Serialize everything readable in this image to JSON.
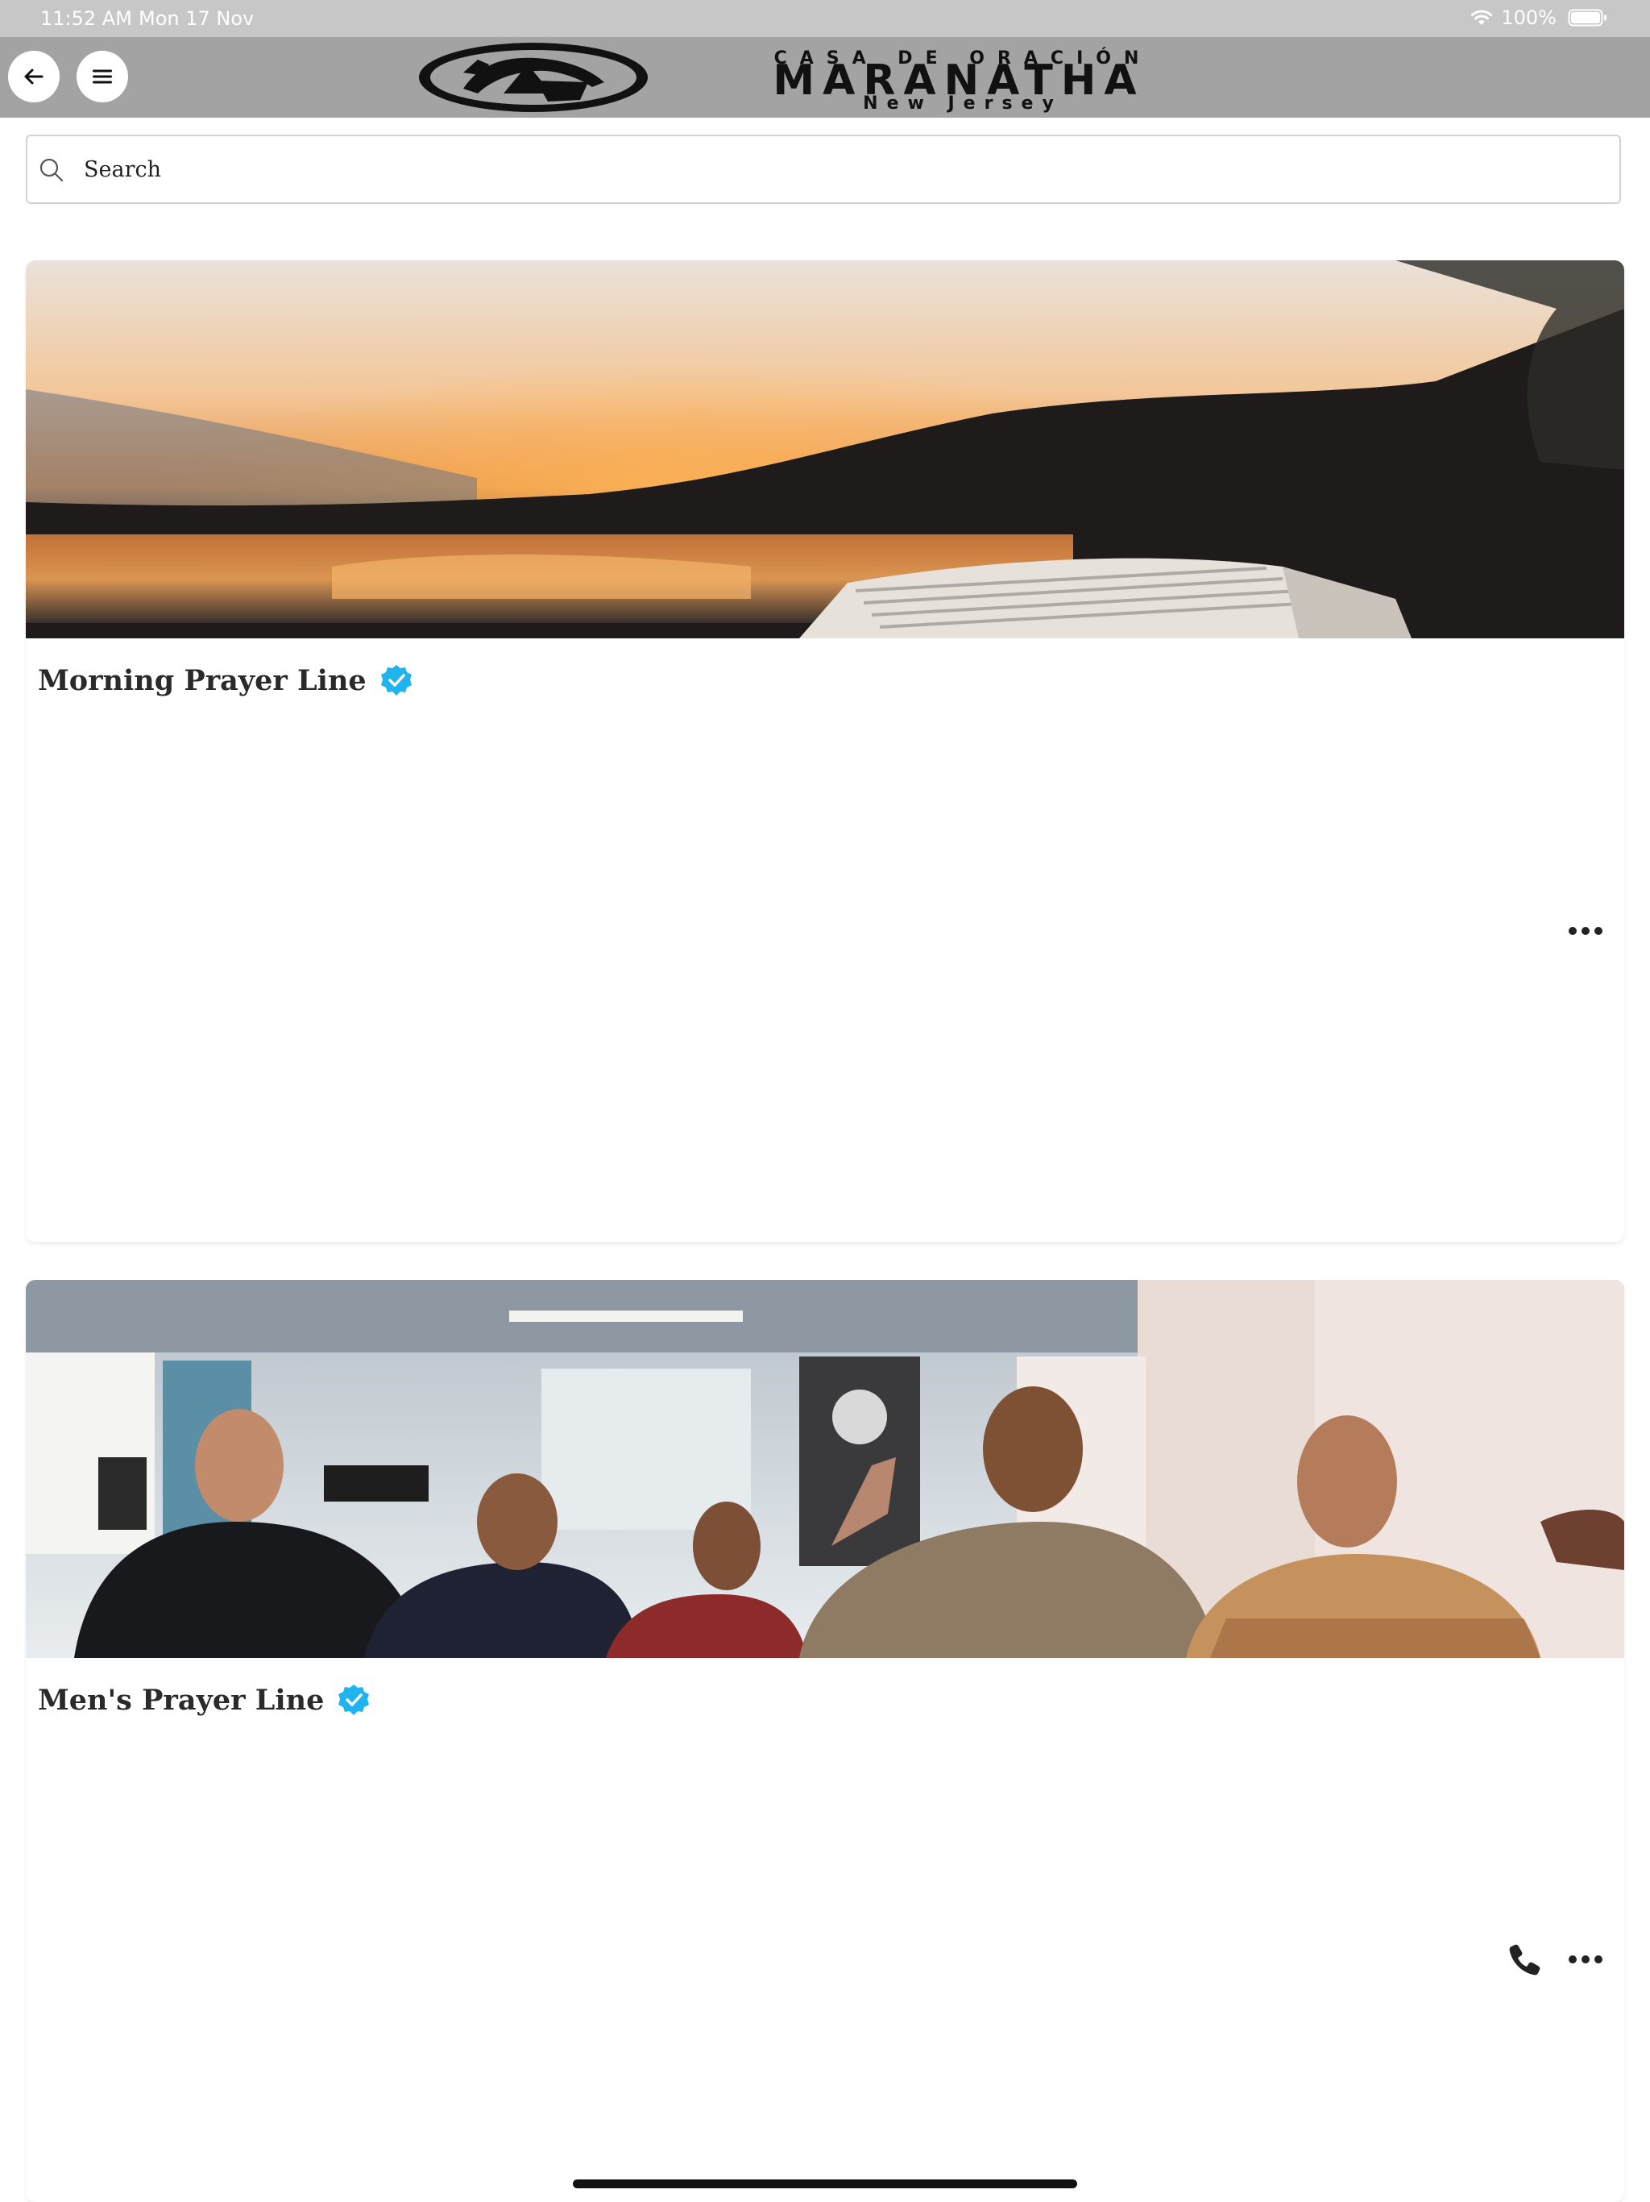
{
  "status_bar": {
    "time": "11:52 AM",
    "date": "Mon 17 Nov",
    "battery": "100%"
  },
  "header": {
    "logo": {
      "top_text": "CASA DE ORACIÓN",
      "main_text": "MARANATHA",
      "sub_text": "New Jersey"
    },
    "icons": {
      "back": "arrow-left-icon",
      "menu": "hamburger-menu-icon"
    },
    "background_color": "#a3a3a3"
  },
  "search": {
    "placeholder": "Search",
    "value": ""
  },
  "cards": [
    {
      "title": "Morning Prayer Line",
      "verified": true,
      "image": "sunset-lake-open-bible",
      "actions": [
        "more-options"
      ]
    },
    {
      "title": "Men's Prayer Line",
      "verified": true,
      "image": "men-praying-together",
      "actions": [
        "call",
        "more-options"
      ]
    }
  ],
  "colors": {
    "verified_badge": "#1fb4ef",
    "status_bar": "#c7c7c7",
    "text": "#2a2a2a"
  }
}
